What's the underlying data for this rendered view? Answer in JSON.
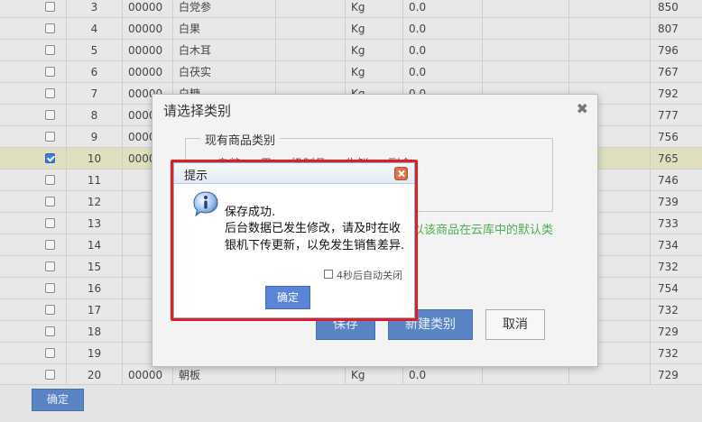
{
  "table": {
    "rows": [
      {
        "idx": "3",
        "code": "00000",
        "name": "白党参",
        "unit": "Kg",
        "price": "0.0",
        "stock": "850",
        "checked": false
      },
      {
        "idx": "4",
        "code": "00000",
        "name": "白果",
        "unit": "Kg",
        "price": "0.0",
        "stock": "807",
        "checked": false
      },
      {
        "idx": "5",
        "code": "00000",
        "name": "白木耳",
        "unit": "Kg",
        "price": "0.0",
        "stock": "796",
        "checked": false
      },
      {
        "idx": "6",
        "code": "00000",
        "name": "白茯实",
        "unit": "Kg",
        "price": "0.0",
        "stock": "767",
        "checked": false
      },
      {
        "idx": "7",
        "code": "00000",
        "name": "白糖",
        "unit": "Kg",
        "price": "0.0",
        "stock": "792",
        "checked": false
      },
      {
        "idx": "8",
        "code": "00000",
        "name": "",
        "unit": "",
        "price": "",
        "stock": "777",
        "checked": false
      },
      {
        "idx": "9",
        "code": "00000",
        "name": "",
        "unit": "",
        "price": "",
        "stock": "756",
        "checked": false
      },
      {
        "idx": "10",
        "code": "0000",
        "name": "",
        "unit": "",
        "price": "",
        "stock": "765",
        "checked": true
      },
      {
        "idx": "11",
        "code": "",
        "name": "",
        "unit": "",
        "price": "",
        "stock": "746",
        "checked": false
      },
      {
        "idx": "12",
        "code": "",
        "name": "",
        "unit": "",
        "price": "",
        "stock": "739",
        "checked": false
      },
      {
        "idx": "13",
        "code": "",
        "name": "",
        "unit": "",
        "price": "",
        "stock": "733",
        "checked": false
      },
      {
        "idx": "14",
        "code": "",
        "name": "",
        "unit": "",
        "price": "",
        "stock": "734",
        "checked": false
      },
      {
        "idx": "15",
        "code": "",
        "name": "",
        "unit": "",
        "price": "",
        "stock": "732",
        "checked": false
      },
      {
        "idx": "16",
        "code": "",
        "name": "",
        "unit": "",
        "price": "",
        "stock": "754",
        "checked": false
      },
      {
        "idx": "17",
        "code": "",
        "name": "",
        "unit": "",
        "price": "",
        "stock": "732",
        "checked": false
      },
      {
        "idx": "18",
        "code": "",
        "name": "",
        "unit": "",
        "price": "",
        "stock": "729",
        "checked": false
      },
      {
        "idx": "19",
        "code": "",
        "name": "",
        "unit": "",
        "price": "",
        "stock": "732",
        "checked": false
      },
      {
        "idx": "20",
        "code": "00000",
        "name": "朝板",
        "unit": "Kg",
        "price": "0.0",
        "stock": "729",
        "checked": false
      }
    ]
  },
  "bottom_bar": {
    "confirm_label": "确定"
  },
  "category_dialog": {
    "title": "请选择类别",
    "group_legend": "现有商品类别",
    "group_items": "… 杂粮 … 果 … 奶制品 … 生鲜 … 副食",
    "hint": "以该商品在云库中的默认类",
    "save_label": "保存",
    "new_label": "新建类别",
    "cancel_label": "取消"
  },
  "alert": {
    "title": "提示",
    "line1": "保存成功.",
    "line2": "后台数据已发生修改，请及时在收",
    "line3": "银机下传更新，以免发生销售差异.",
    "auto_close_label": "4秒后自动关闭",
    "ok_label": "确定",
    "icon": "info-icon"
  },
  "colors": {
    "highlight": "#e02020",
    "primary_button": "#5b84c4",
    "hint_text": "#4caf50"
  }
}
